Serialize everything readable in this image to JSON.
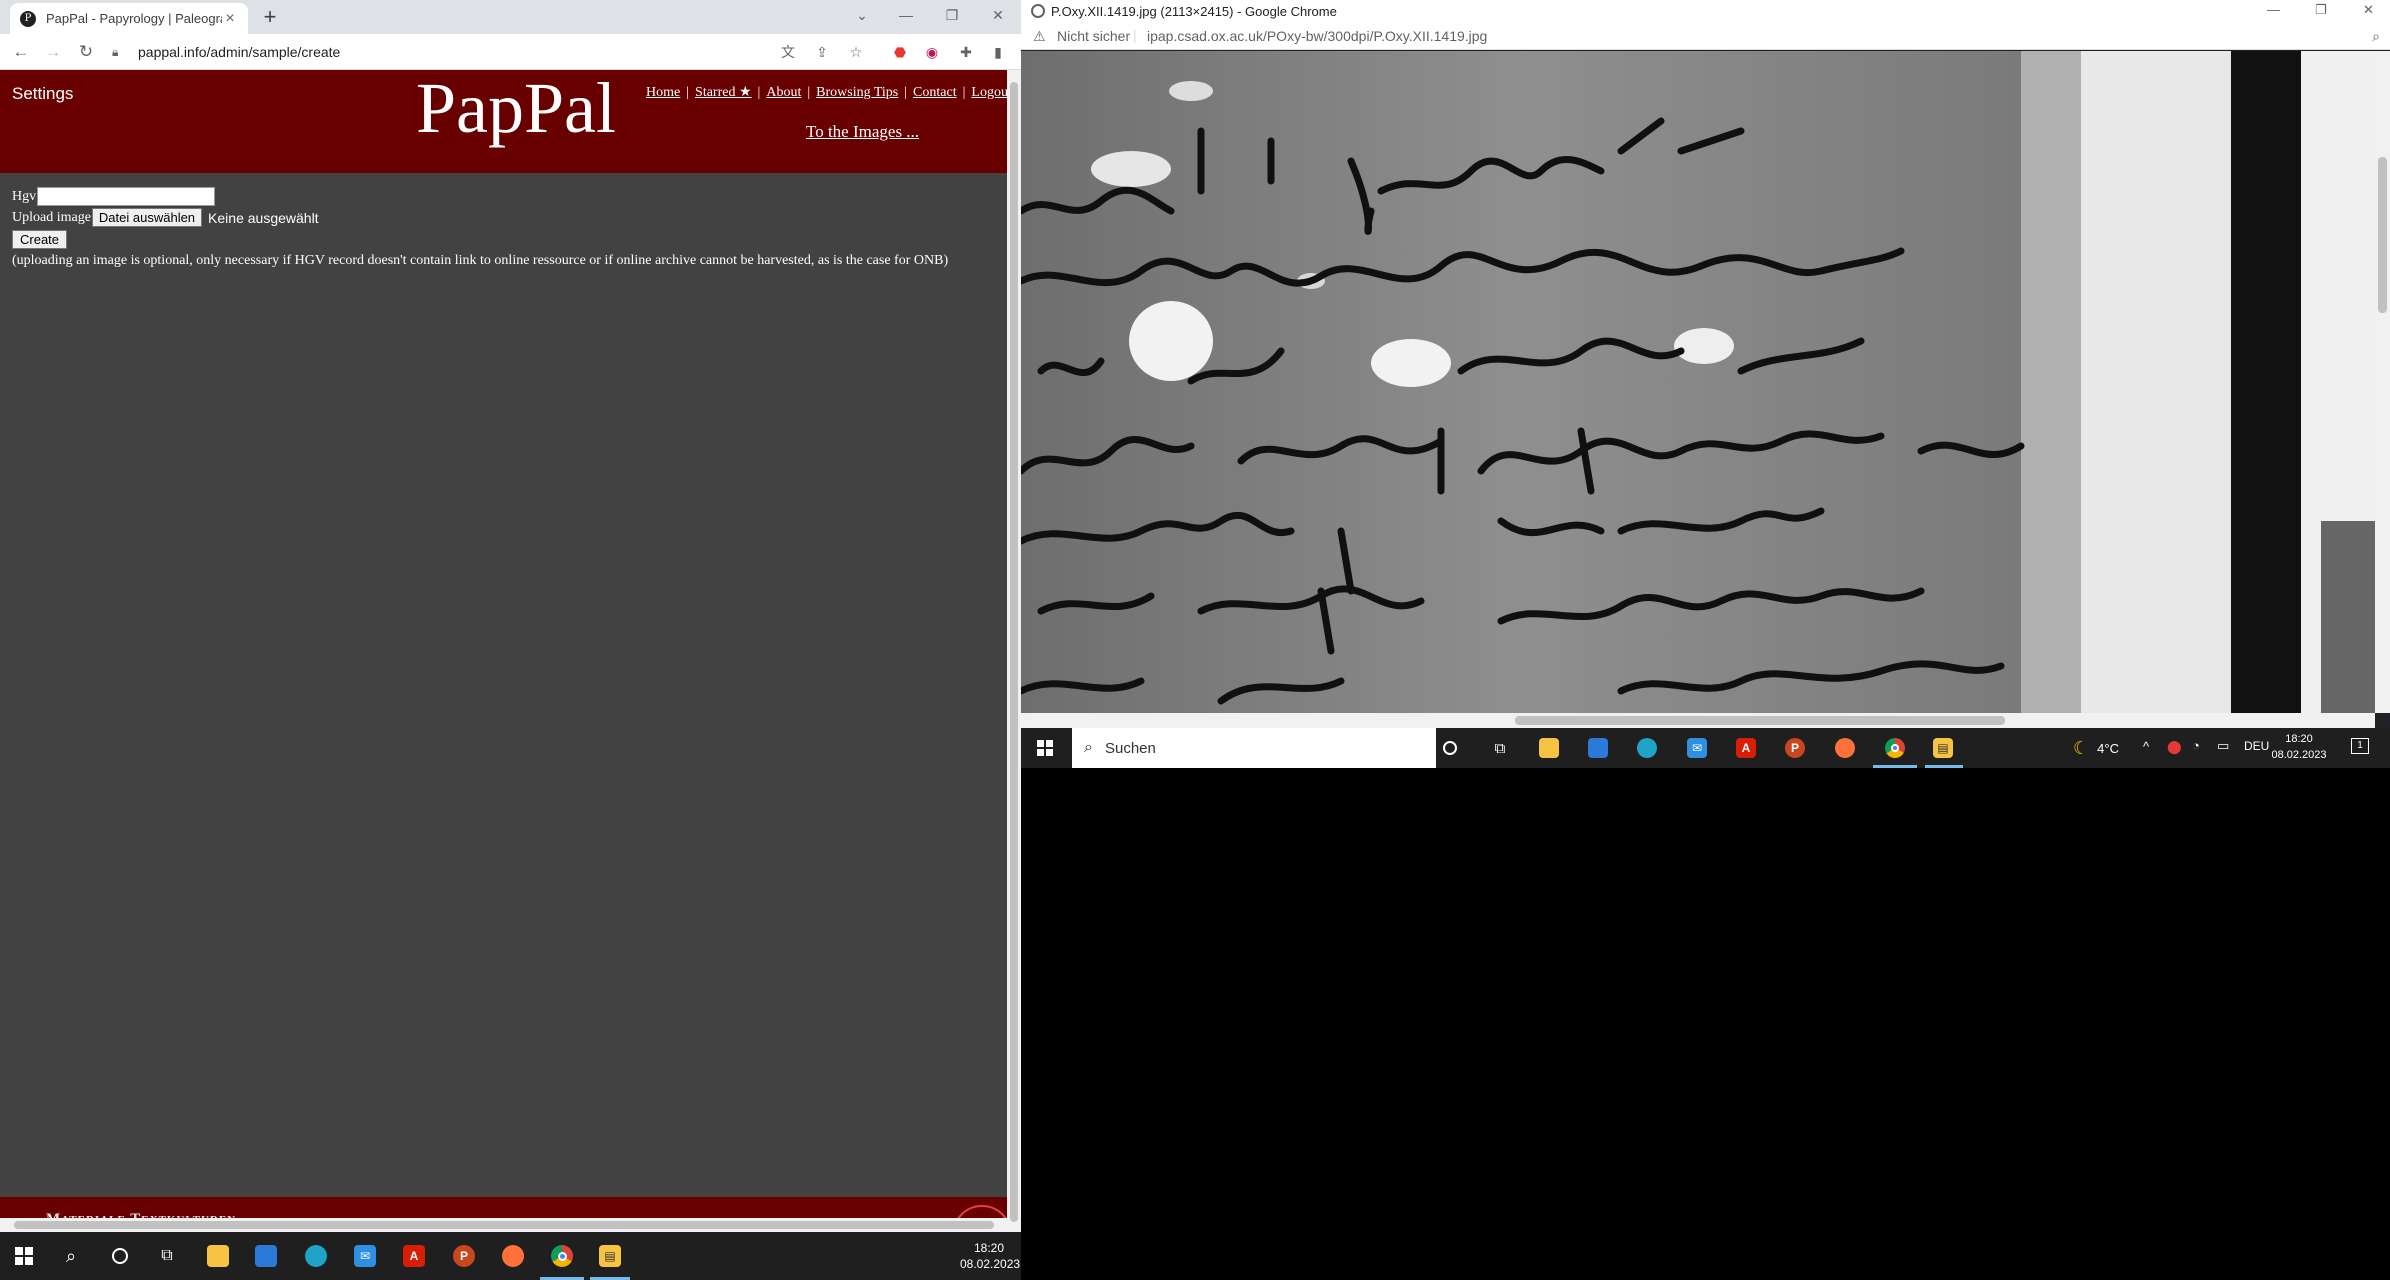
{
  "left_browser": {
    "tab": {
      "title": "PapPal - Papyrology | Paleograph",
      "favicon_letter": "P"
    },
    "address": "pappal.info/admin/sample/create",
    "profile_letter": "C"
  },
  "site": {
    "settings_label": "Settings",
    "logo": "PapPal",
    "nav": [
      "Home",
      "Starred ★",
      "About",
      "Browsing Tips",
      "Contact",
      "Logou"
    ],
    "to_images": "To the Images ...",
    "form": {
      "hgv_label": "Hgv",
      "hgv_value": "",
      "upload_label": "Upload image",
      "file_button": "Datei auswählen",
      "file_status": "Keine ausgewählt",
      "create_button": "Create",
      "note": "(uploading an image is optional, only necessary if HGV record doesn't contain link to online ressource or if online archive cannot be harvested, as is the case for ONB)"
    },
    "footer_text": "Materiale Textkulturen"
  },
  "right_browser": {
    "window_title": "P.Oxy.XII.1419.jpg (2113×2415) - Google Chrome",
    "security": "Nicht sicher",
    "address": "ipap.csad.ox.ac.uk/POxy-bw/300dpi/P.Oxy.XII.1419.jpg"
  },
  "taskbar_left": {
    "time": "18:20",
    "date": "08.02.2023"
  },
  "taskbar_right": {
    "search_placeholder": "Suchen",
    "weather": "4°C",
    "language": "DEU",
    "time": "18:20",
    "date": "08.02.2023",
    "notification_count": "1"
  },
  "colors": {
    "header_red": "#690000",
    "content_grey": "#424242",
    "taskbar": "#1f1f1f"
  }
}
